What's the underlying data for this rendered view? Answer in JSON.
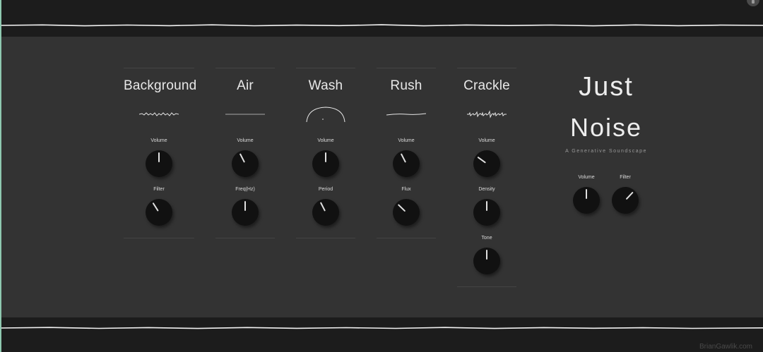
{
  "app": {
    "title_line1": "Just",
    "title_line2": "Noise",
    "subtitle": "A Generative Soundscape",
    "credit": "BrianGawlik.com"
  },
  "channels": [
    {
      "name": "Background",
      "knobs": [
        {
          "label": "Volume",
          "value": 0.5
        },
        {
          "label": "Filter",
          "value": 0.38
        }
      ]
    },
    {
      "name": "Air",
      "knobs": [
        {
          "label": "Volume",
          "value": 0.4
        },
        {
          "label": "Freq(Hz)",
          "value": 0.5
        }
      ]
    },
    {
      "name": "Wash",
      "knobs": [
        {
          "label": "Volume",
          "value": 0.5
        },
        {
          "label": "Period",
          "value": 0.4
        }
      ]
    },
    {
      "name": "Rush",
      "knobs": [
        {
          "label": "Volume",
          "value": 0.4
        },
        {
          "label": "Flux",
          "value": 0.33
        }
      ]
    },
    {
      "name": "Crackle",
      "knobs": [
        {
          "label": "Volume",
          "value": 0.3
        },
        {
          "label": "Density",
          "value": 0.5
        },
        {
          "label": "Tone",
          "value": 0.5
        }
      ]
    }
  ],
  "master": {
    "knobs": [
      {
        "label": "Volume",
        "value": 0.5
      },
      {
        "label": "Filter",
        "value": 0.66
      }
    ]
  },
  "colors": {
    "background": "#333333",
    "bars": "#1c1c1c",
    "knob": "#111111",
    "accent": "#8fc9b0"
  }
}
